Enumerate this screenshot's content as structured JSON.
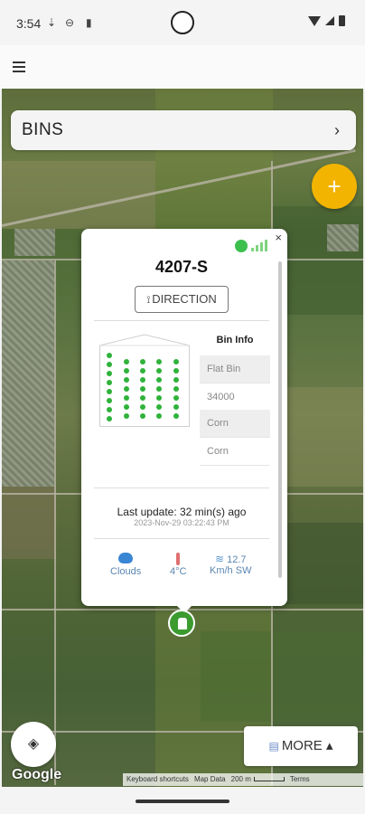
{
  "status_bar": {
    "time": "3:54"
  },
  "app_bar": {
    "menu_icon": "menu-icon"
  },
  "map": {
    "bins_label": "BINS",
    "bins_chevron": "›",
    "add_symbol": "+",
    "more_label": "MORE",
    "more_arrow": "▴",
    "google_logo": "Google",
    "attribution": {
      "shortcuts": "Keyboard shortcuts",
      "map_data": "Map Data",
      "scale": "200 m",
      "terms": "Terms"
    }
  },
  "popup": {
    "close": "×",
    "bin_name": "4207-S",
    "direction_label": "DIRECTION",
    "bin_info_title": "Bin Info",
    "bin_info_rows": [
      "Flat Bin",
      "34000",
      "Corn",
      "Corn"
    ],
    "last_update": "Last update: 32 min(s) ago",
    "last_update_time": "2023-Nov-29 03:22:43 PM",
    "weather": {
      "condition": "Clouds",
      "temperature": "4°C",
      "wind_speed": "12.7",
      "wind_unit": "Km/h SW"
    }
  },
  "colors": {
    "accent": "#f2b400",
    "status_online": "#3cbf4d",
    "sensor_dot": "#2fb23a",
    "pin": "#3b9b2e"
  }
}
